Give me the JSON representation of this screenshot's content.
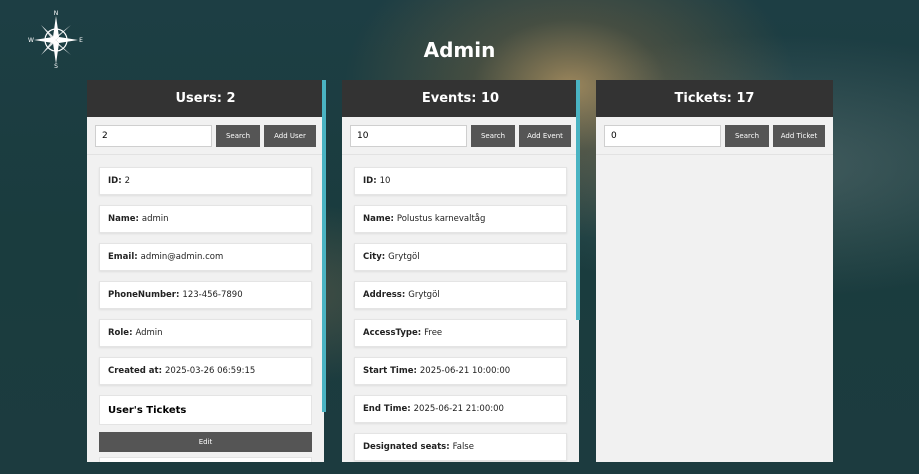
{
  "page": {
    "title": "Admin"
  },
  "icons": {
    "logo": "compass-rose-icon"
  },
  "users": {
    "header": "Users: 2",
    "search_value": "2",
    "search_label": "Search",
    "add_label": "Add User",
    "fields": [
      {
        "label": "ID:",
        "value": "2"
      },
      {
        "label": "Name:",
        "value": "admin"
      },
      {
        "label": "Email:",
        "value": "admin@admin.com"
      },
      {
        "label": "PhoneNumber:",
        "value": "123-456-7890"
      },
      {
        "label": "Role:",
        "value": "Admin"
      },
      {
        "label": "Created at:",
        "value": "2025-03-26 06:59:15"
      }
    ],
    "tickets_heading": "User's Tickets",
    "edit_label": "Edit"
  },
  "events": {
    "header": "Events: 10",
    "search_value": "10",
    "search_label": "Search",
    "add_label": "Add Event",
    "fields": [
      {
        "label": "ID:",
        "value": "10"
      },
      {
        "label": "Name:",
        "value": "Polustus karnevaltåg"
      },
      {
        "label": "City:",
        "value": "Grytgöl"
      },
      {
        "label": "Address:",
        "value": "Grytgöl"
      },
      {
        "label": "AccessType:",
        "value": "Free"
      },
      {
        "label": "Start Time:",
        "value": "2025-06-21 10:00:00"
      },
      {
        "label": "End Time:",
        "value": "2025-06-21 21:00:00"
      },
      {
        "label": "Designated seats:",
        "value": "False"
      }
    ]
  },
  "tickets": {
    "header": "Tickets: 17",
    "search_value": "0",
    "search_label": "Search",
    "add_label": "Add Ticket"
  },
  "colors": {
    "panel_header": "#333333",
    "button": "#555555",
    "scroll_accent": "#4ab3c2",
    "panel_bg": "#f1f1f1"
  }
}
